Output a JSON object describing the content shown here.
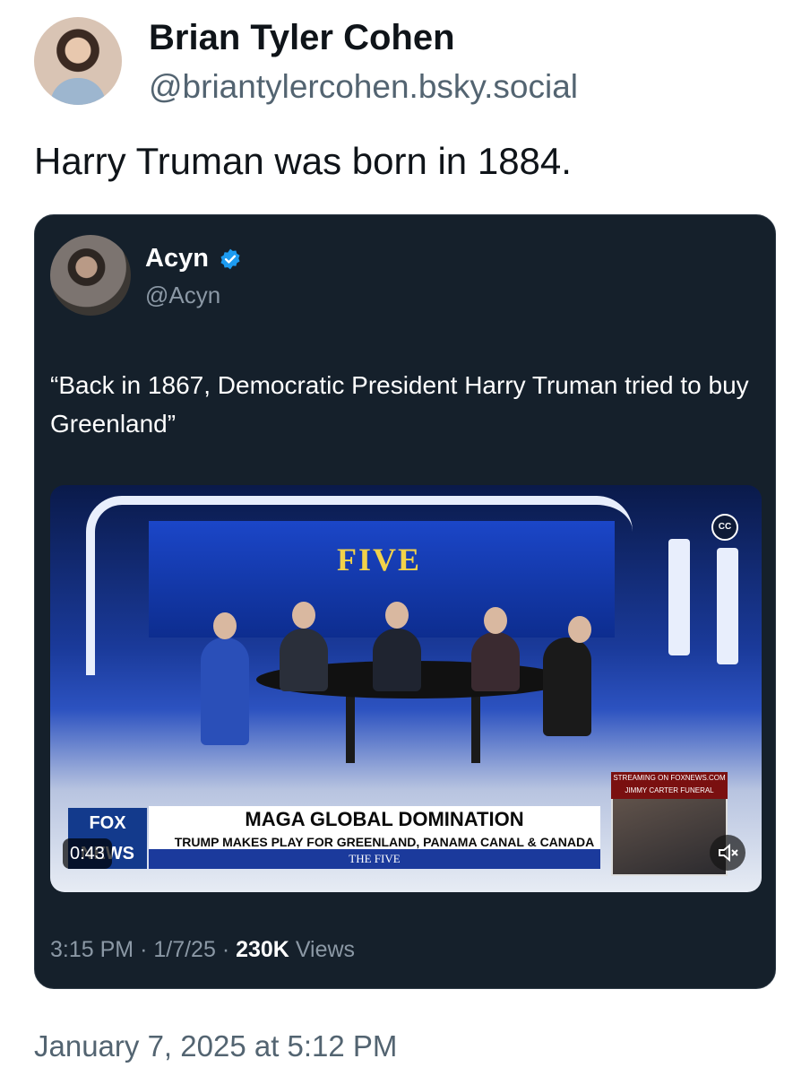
{
  "post": {
    "author_name": "Brian Tyler Cohen",
    "author_handle": "@briantylercohen.bsky.social",
    "text": "Harry Truman was born in 1884.",
    "timestamp": "January 7, 2025 at 5:12 PM"
  },
  "quoted_post": {
    "author_name": "Acyn",
    "author_handle": "@Acyn",
    "verified": true,
    "text": "“Back in 1867, Democratic President Harry Truman tried to buy Greenland”",
    "time": "3:15 PM",
    "date": "1/7/25",
    "views_count": "230K",
    "views_label": "Views",
    "separator": "·"
  },
  "video": {
    "duration": "0:43",
    "show_logo": "FIVE",
    "network_logo": "FOX NEWS",
    "headline": "MAGA GLOBAL DOMINATION",
    "subheadline": "TRUMP MAKES PLAY FOR GREENLAND, PANAMA CANAL & CANADA",
    "bottom_strip": "THE FIVE",
    "inset_banner_line1": "STREAMING ON FOXNEWS.COM",
    "inset_banner_line2": "JIMMY CARTER FUNERAL",
    "cc_label": "CC"
  },
  "colors": {
    "card_background": "#15202b",
    "verified_blue": "#1d9bf0",
    "muted_text": "#536471"
  },
  "icons": [
    "verified-badge-icon",
    "closed-captions-icon",
    "mute-icon"
  ]
}
